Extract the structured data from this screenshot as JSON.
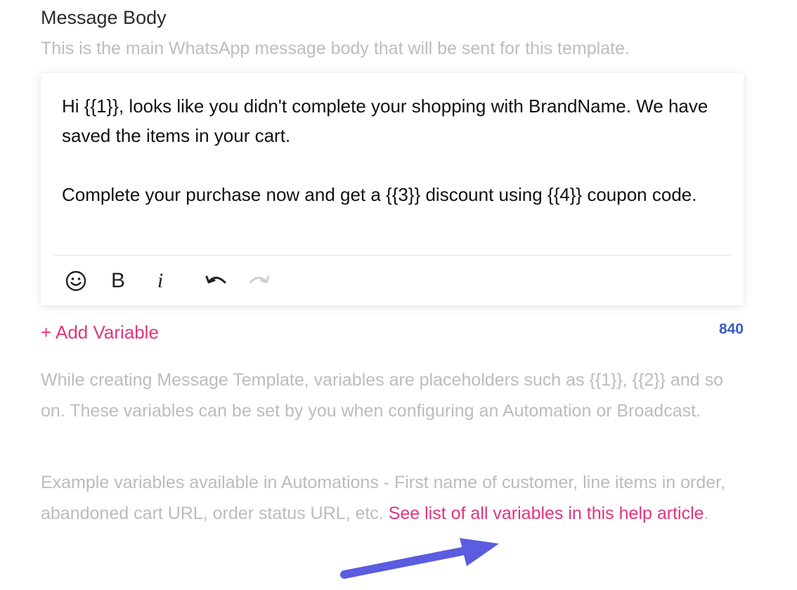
{
  "section": {
    "title": "Message Body",
    "subtitle": "This is the main WhatsApp message body that will be sent for this template."
  },
  "editor": {
    "line1": "Hi {{1}}, looks like you didn't complete your shopping with BrandName. We have saved the items in your cart.",
    "line2": "Complete your purchase now and get a {{3}} discount using {{4}} coupon code.",
    "toolbar": {
      "bold_label": "B",
      "italic_label": "i",
      "icons": [
        "smiley-icon",
        "bold-icon",
        "italic-icon",
        "undo-icon",
        "redo-icon"
      ]
    }
  },
  "add_variable_label": "+ Add Variable",
  "char_count": "840",
  "help": {
    "para1": "While creating Message Template, variables are placeholders such as {{1}}, {{2}} and so on. These variables can be set by you when configuring an Automation or Broadcast.",
    "para2_text": "Example variables available in Automations - First name of customer, line items in order, abandoned cart URL, order status URL, etc. ",
    "para2_link": "See list of all variables in this help article",
    "para2_end": "."
  },
  "colors": {
    "accent_pink": "#e0357d",
    "count_blue": "#3a5cc5",
    "muted_text": "#bcbcbc",
    "arrow": "#5b5ce0"
  }
}
